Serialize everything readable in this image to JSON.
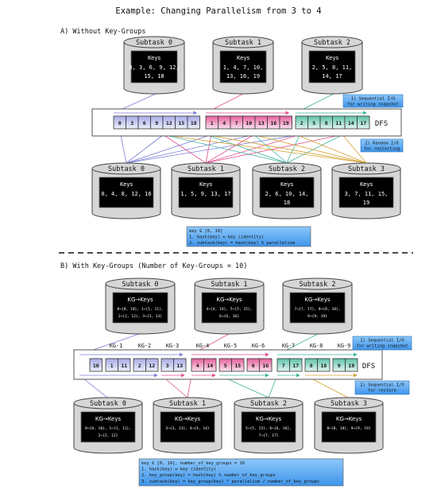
{
  "title": "Example: Changing Parallelism from 3 to 4",
  "colors": {
    "subtask0": "#7b7fd6",
    "subtask1": "#e0508f",
    "subtask2": "#3fb39a",
    "subtask3": "#d4a030",
    "cylinder_fill": "#d6d6d6",
    "note_fill": "#5aa8f0",
    "inner_box": "#000000"
  },
  "section_a": {
    "heading": "A) Without Key-Groups",
    "old_subtasks": [
      {
        "label": "Subtask 0",
        "header": "Keys",
        "lines": [
          "0, 3, 6, 9, 12,",
          "15, 18"
        ]
      },
      {
        "label": "Subtask 1",
        "header": "Keys",
        "lines": [
          "1, 4, 7, 10,",
          "13, 16, 19"
        ]
      },
      {
        "label": "Subtask 2",
        "header": "Keys",
        "lines": [
          "2, 5, 8, 11,",
          "14, 17"
        ]
      }
    ],
    "dfs": {
      "label": "DFS",
      "groups": [
        {
          "owner": 0,
          "cells": [
            "0",
            "3",
            "6",
            "9",
            "12",
            "15",
            "18"
          ]
        },
        {
          "owner": 1,
          "cells": [
            "1",
            "4",
            "7",
            "10",
            "13",
            "16",
            "19"
          ]
        },
        {
          "owner": 2,
          "cells": [
            "2",
            "5",
            "8",
            "11",
            "14",
            "17"
          ]
        }
      ]
    },
    "note_write": [
      "1) Sequential I/O",
      "for writing snapshot"
    ],
    "note_restore": [
      "2) Random I/O",
      "for restorting"
    ],
    "new_subtasks": [
      {
        "label": "Subtask 0",
        "header": "Keys",
        "lines": [
          "0, 4, 8, 12, 16"
        ]
      },
      {
        "label": "Subtask 1",
        "header": "Keys",
        "lines": [
          "1, 5, 9, 13, 17"
        ]
      },
      {
        "label": "Subtask 2",
        "header": "Keys",
        "lines": [
          "2, 6, 10, 14,",
          "18"
        ]
      },
      {
        "label": "Subtask 3",
        "header": "Keys",
        "lines": [
          "3, 7, 11, 15,",
          "19"
        ]
      }
    ],
    "formula": [
      "key ∈ [0, 19]",
      "1. hash(key) = key (identity)",
      "2. subtask(key) = hash(key) % parallelism"
    ]
  },
  "section_b": {
    "heading": "B) With Key-Groups (Number of Key-Groups = 10)",
    "old_subtasks": [
      {
        "label": "Subtask 0",
        "header": "KG→Keys",
        "lines": [
          "0→{0, 10}, 1→{1, 11},",
          "2→{2, 12}, 3→{3, 13}"
        ]
      },
      {
        "label": "Subtask 1",
        "header": "KG→Keys",
        "lines": [
          "4→{4, 14}, 5→{5, 15},",
          "6→{6, 16}"
        ]
      },
      {
        "label": "Subtask 2",
        "header": "KG→Keys",
        "lines": [
          "7→{7, 17}, 8→{8, 18},",
          "9→{9, 19}"
        ]
      }
    ],
    "kg_labels": [
      "KG-1",
      "KG-2",
      "KG-3",
      "KG-4",
      "KG-5",
      "KG-6",
      "KG-7",
      "KG-8",
      "KG-9"
    ],
    "dfs": {
      "label": "DFS",
      "key_groups": [
        {
          "kg": 0,
          "owner": 0,
          "cells": [
            "10"
          ]
        },
        {
          "kg": 1,
          "owner": 0,
          "cells": [
            "1",
            "11"
          ]
        },
        {
          "kg": 2,
          "owner": 0,
          "cells": [
            "2",
            "12"
          ]
        },
        {
          "kg": 3,
          "owner": 0,
          "cells": [
            "3",
            "13"
          ]
        },
        {
          "kg": 4,
          "owner": 1,
          "cells": [
            "4",
            "14"
          ]
        },
        {
          "kg": 5,
          "owner": 1,
          "cells": [
            "5",
            "15"
          ]
        },
        {
          "kg": 6,
          "owner": 1,
          "cells": [
            "6",
            "16"
          ]
        },
        {
          "kg": 7,
          "owner": 2,
          "cells": [
            "7",
            "17"
          ]
        },
        {
          "kg": 8,
          "owner": 2,
          "cells": [
            "8",
            "18"
          ]
        },
        {
          "kg": 9,
          "owner": 2,
          "cells": [
            "9",
            "19"
          ]
        }
      ]
    },
    "note_write": [
      "1) Sequential I/O",
      "for writing snapshot"
    ],
    "note_restore": [
      "2) Sequential I/O",
      "for restore"
    ],
    "new_subtasks": [
      {
        "label": "Subtask 0",
        "header": "KG→Keys",
        "lines": [
          "0→{0, 10}, 1→{1, 11},",
          "2→{2, 12}"
        ]
      },
      {
        "label": "Subtask 1",
        "header": "KG→Keys",
        "lines": [
          "3→{3, 13}, 4→{4, 14}"
        ]
      },
      {
        "label": "Subtask 2",
        "header": "KG→Keys",
        "lines": [
          "5→{5, 15}, 6→{6, 16},",
          "7→{7, 17}"
        ]
      },
      {
        "label": "Subtask 3",
        "header": "KG→Keys",
        "lines": [
          "8→{8, 18}, 9→{9, 19}"
        ]
      }
    ],
    "formula": [
      "key ∈ [0, 19], number_of_key_groups = 10",
      "1. hash(key) = key (identity)",
      "2. key_group(key) = hash(key) % number_of_key_groups",
      "3. subtask(key) = key_group(key) * parallelism / number_of_key_groups"
    ]
  }
}
